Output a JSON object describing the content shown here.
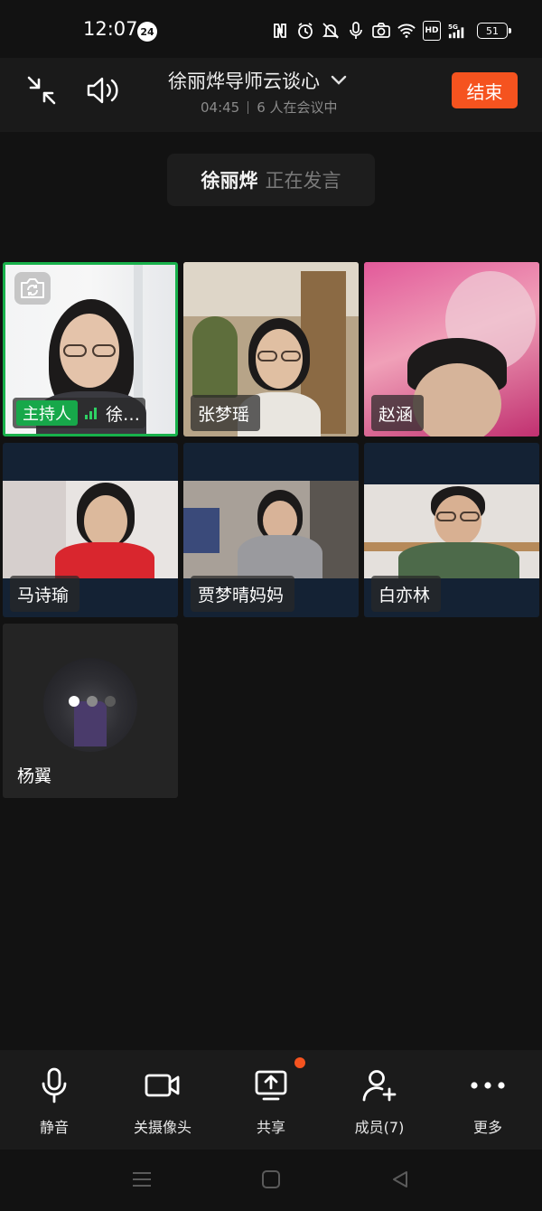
{
  "status_bar": {
    "time": "12:07",
    "notification_count": "24",
    "network_hd": "HD",
    "network_5g": "5G",
    "battery": "51"
  },
  "header": {
    "meeting_title": "徐丽烨导师云谈心",
    "duration": "04:45",
    "participants_text": "6 人在会议中",
    "end_button": "结束",
    "accent_color": "#f5531f"
  },
  "speaker": {
    "name": "徐丽烨",
    "status": "正在发言"
  },
  "tiles": {
    "host": {
      "badge": "主持人",
      "name": "徐…"
    },
    "t2": {
      "name": "张梦瑶"
    },
    "t3": {
      "name": "赵涵"
    },
    "t4": {
      "name": "马诗瑜"
    },
    "t5": {
      "name": "贾梦晴妈妈"
    },
    "t6": {
      "name": "白亦林"
    },
    "t7": {
      "name": "杨翼"
    }
  },
  "toolbar": {
    "mute": "静音",
    "camera_off": "关摄像头",
    "share": "共享",
    "members": "成员(7)",
    "more": "更多"
  }
}
